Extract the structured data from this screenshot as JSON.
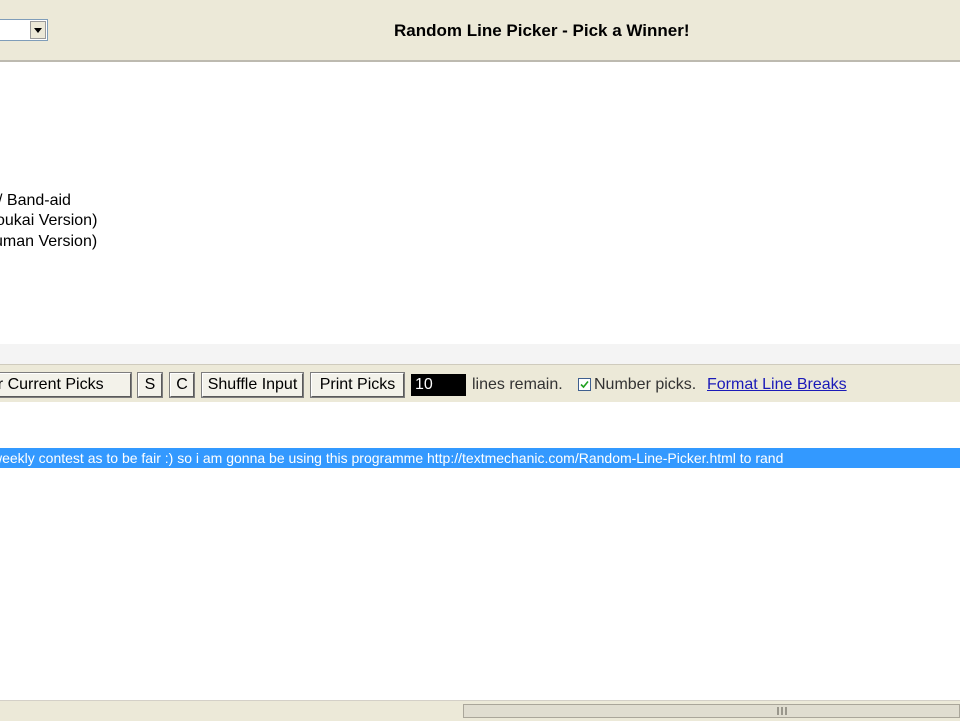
{
  "header": {
    "title": "Random Line Picker - Pick a Winner!"
  },
  "input": {
    "lines": [
      "/ Band-aid",
      "oukai Version)",
      "uman Version)"
    ]
  },
  "toolbar": {
    "clear_picks_label": "ear Current Picks",
    "s_label": "S",
    "c_label": "C",
    "shuffle_label": "Shuffle Input",
    "print_label": "Print Picks",
    "remaining_count": "10",
    "remaining_text": "lines remain.",
    "number_picks_checked": true,
    "number_picks_label": "Number picks.",
    "format_link_label": "Format Line Breaks"
  },
  "output": {
    "selected_line": "weekly contest as to be fair :) so i am gonna be using this programme http://textmechanic.com/Random-Line-Picker.html  to rand"
  },
  "colors": {
    "chrome": "#ece9d8",
    "selection": "#3399ff",
    "link": "#1a1ab8"
  },
  "icons": {
    "dropdown": "chevron-down-icon",
    "checkbox": "check-icon",
    "scrollbar_grip": "grip-icon"
  }
}
